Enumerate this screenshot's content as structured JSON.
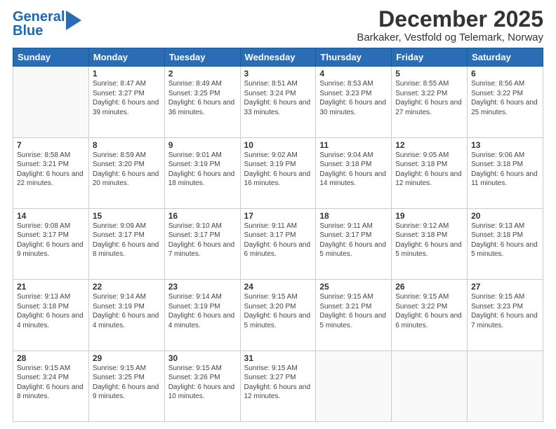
{
  "logo": {
    "line1": "General",
    "line2": "Blue"
  },
  "title": "December 2025",
  "subtitle": "Barkaker, Vestfold og Telemark, Norway",
  "days_of_week": [
    "Sunday",
    "Monday",
    "Tuesday",
    "Wednesday",
    "Thursday",
    "Friday",
    "Saturday"
  ],
  "weeks": [
    [
      {
        "day": "",
        "sunrise": "",
        "sunset": "",
        "daylight": ""
      },
      {
        "day": "1",
        "sunrise": "Sunrise: 8:47 AM",
        "sunset": "Sunset: 3:27 PM",
        "daylight": "Daylight: 6 hours and 39 minutes."
      },
      {
        "day": "2",
        "sunrise": "Sunrise: 8:49 AM",
        "sunset": "Sunset: 3:25 PM",
        "daylight": "Daylight: 6 hours and 36 minutes."
      },
      {
        "day": "3",
        "sunrise": "Sunrise: 8:51 AM",
        "sunset": "Sunset: 3:24 PM",
        "daylight": "Daylight: 6 hours and 33 minutes."
      },
      {
        "day": "4",
        "sunrise": "Sunrise: 8:53 AM",
        "sunset": "Sunset: 3:23 PM",
        "daylight": "Daylight: 6 hours and 30 minutes."
      },
      {
        "day": "5",
        "sunrise": "Sunrise: 8:55 AM",
        "sunset": "Sunset: 3:22 PM",
        "daylight": "Daylight: 6 hours and 27 minutes."
      },
      {
        "day": "6",
        "sunrise": "Sunrise: 8:56 AM",
        "sunset": "Sunset: 3:22 PM",
        "daylight": "Daylight: 6 hours and 25 minutes."
      }
    ],
    [
      {
        "day": "7",
        "sunrise": "Sunrise: 8:58 AM",
        "sunset": "Sunset: 3:21 PM",
        "daylight": "Daylight: 6 hours and 22 minutes."
      },
      {
        "day": "8",
        "sunrise": "Sunrise: 8:59 AM",
        "sunset": "Sunset: 3:20 PM",
        "daylight": "Daylight: 6 hours and 20 minutes."
      },
      {
        "day": "9",
        "sunrise": "Sunrise: 9:01 AM",
        "sunset": "Sunset: 3:19 PM",
        "daylight": "Daylight: 6 hours and 18 minutes."
      },
      {
        "day": "10",
        "sunrise": "Sunrise: 9:02 AM",
        "sunset": "Sunset: 3:19 PM",
        "daylight": "Daylight: 6 hours and 16 minutes."
      },
      {
        "day": "11",
        "sunrise": "Sunrise: 9:04 AM",
        "sunset": "Sunset: 3:18 PM",
        "daylight": "Daylight: 6 hours and 14 minutes."
      },
      {
        "day": "12",
        "sunrise": "Sunrise: 9:05 AM",
        "sunset": "Sunset: 3:18 PM",
        "daylight": "Daylight: 6 hours and 12 minutes."
      },
      {
        "day": "13",
        "sunrise": "Sunrise: 9:06 AM",
        "sunset": "Sunset: 3:18 PM",
        "daylight": "Daylight: 6 hours and 11 minutes."
      }
    ],
    [
      {
        "day": "14",
        "sunrise": "Sunrise: 9:08 AM",
        "sunset": "Sunset: 3:17 PM",
        "daylight": "Daylight: 6 hours and 9 minutes."
      },
      {
        "day": "15",
        "sunrise": "Sunrise: 9:09 AM",
        "sunset": "Sunset: 3:17 PM",
        "daylight": "Daylight: 6 hours and 8 minutes."
      },
      {
        "day": "16",
        "sunrise": "Sunrise: 9:10 AM",
        "sunset": "Sunset: 3:17 PM",
        "daylight": "Daylight: 6 hours and 7 minutes."
      },
      {
        "day": "17",
        "sunrise": "Sunrise: 9:11 AM",
        "sunset": "Sunset: 3:17 PM",
        "daylight": "Daylight: 6 hours and 6 minutes."
      },
      {
        "day": "18",
        "sunrise": "Sunrise: 9:11 AM",
        "sunset": "Sunset: 3:17 PM",
        "daylight": "Daylight: 6 hours and 5 minutes."
      },
      {
        "day": "19",
        "sunrise": "Sunrise: 9:12 AM",
        "sunset": "Sunset: 3:18 PM",
        "daylight": "Daylight: 6 hours and 5 minutes."
      },
      {
        "day": "20",
        "sunrise": "Sunrise: 9:13 AM",
        "sunset": "Sunset: 3:18 PM",
        "daylight": "Daylight: 6 hours and 5 minutes."
      }
    ],
    [
      {
        "day": "21",
        "sunrise": "Sunrise: 9:13 AM",
        "sunset": "Sunset: 3:18 PM",
        "daylight": "Daylight: 6 hours and 4 minutes."
      },
      {
        "day": "22",
        "sunrise": "Sunrise: 9:14 AM",
        "sunset": "Sunset: 3:19 PM",
        "daylight": "Daylight: 6 hours and 4 minutes."
      },
      {
        "day": "23",
        "sunrise": "Sunrise: 9:14 AM",
        "sunset": "Sunset: 3:19 PM",
        "daylight": "Daylight: 6 hours and 4 minutes."
      },
      {
        "day": "24",
        "sunrise": "Sunrise: 9:15 AM",
        "sunset": "Sunset: 3:20 PM",
        "daylight": "Daylight: 6 hours and 5 minutes."
      },
      {
        "day": "25",
        "sunrise": "Sunrise: 9:15 AM",
        "sunset": "Sunset: 3:21 PM",
        "daylight": "Daylight: 6 hours and 5 minutes."
      },
      {
        "day": "26",
        "sunrise": "Sunrise: 9:15 AM",
        "sunset": "Sunset: 3:22 PM",
        "daylight": "Daylight: 6 hours and 6 minutes."
      },
      {
        "day": "27",
        "sunrise": "Sunrise: 9:15 AM",
        "sunset": "Sunset: 3:23 PM",
        "daylight": "Daylight: 6 hours and 7 minutes."
      }
    ],
    [
      {
        "day": "28",
        "sunrise": "Sunrise: 9:15 AM",
        "sunset": "Sunset: 3:24 PM",
        "daylight": "Daylight: 6 hours and 8 minutes."
      },
      {
        "day": "29",
        "sunrise": "Sunrise: 9:15 AM",
        "sunset": "Sunset: 3:25 PM",
        "daylight": "Daylight: 6 hours and 9 minutes."
      },
      {
        "day": "30",
        "sunrise": "Sunrise: 9:15 AM",
        "sunset": "Sunset: 3:26 PM",
        "daylight": "Daylight: 6 hours and 10 minutes."
      },
      {
        "day": "31",
        "sunrise": "Sunrise: 9:15 AM",
        "sunset": "Sunset: 3:27 PM",
        "daylight": "Daylight: 6 hours and 12 minutes."
      },
      {
        "day": "",
        "sunrise": "",
        "sunset": "",
        "daylight": ""
      },
      {
        "day": "",
        "sunrise": "",
        "sunset": "",
        "daylight": ""
      },
      {
        "day": "",
        "sunrise": "",
        "sunset": "",
        "daylight": ""
      }
    ]
  ]
}
